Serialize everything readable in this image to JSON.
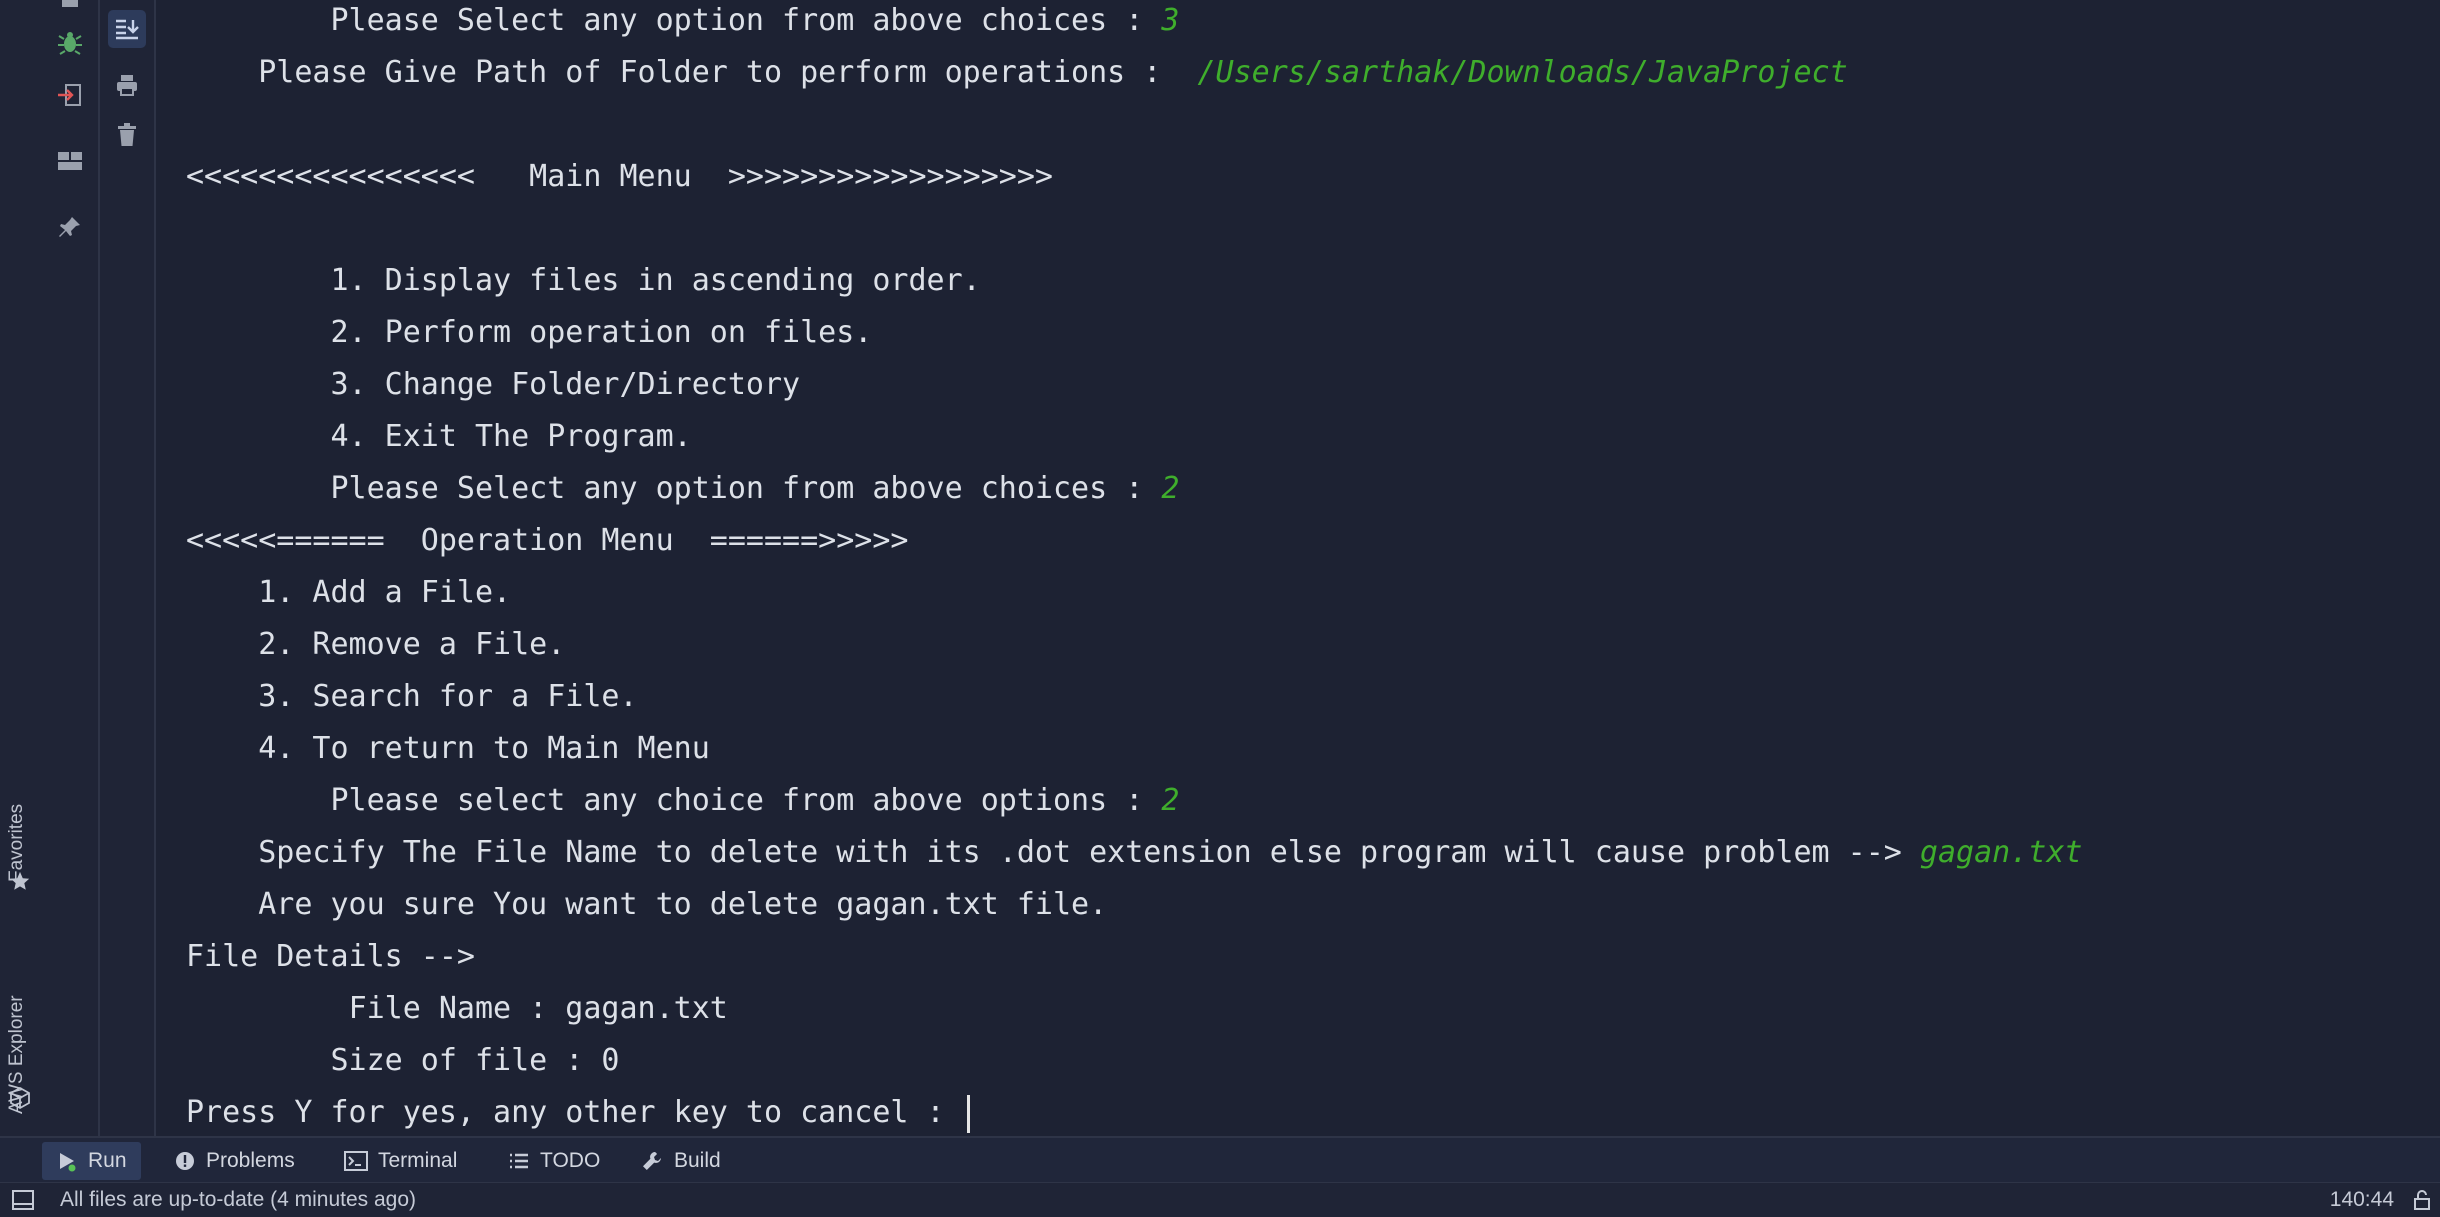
{
  "sidebar": {
    "favorites_label": "Favorites",
    "aws_label": "AWS Explorer"
  },
  "console": {
    "lines": [
      {
        "indent": "        ",
        "text": "Please Select any option from above choices : ",
        "input": "3"
      },
      {
        "indent": "    ",
        "text": "Please Give Path of Folder to perform operations :  ",
        "input": "/Users/sarthak/Downloads/JavaProject"
      },
      {
        "indent": "",
        "text": "",
        "input": ""
      },
      {
        "indent": "",
        "text": "<<<<<<<<<<<<<<<<   Main Menu  >>>>>>>>>>>>>>>>>>",
        "input": ""
      },
      {
        "indent": "",
        "text": "",
        "input": ""
      },
      {
        "indent": "        ",
        "text": "1. Display files in ascending order.",
        "input": ""
      },
      {
        "indent": "        ",
        "text": "2. Perform operation on files.",
        "input": ""
      },
      {
        "indent": "        ",
        "text": "3. Change Folder/Directory",
        "input": ""
      },
      {
        "indent": "        ",
        "text": "4. Exit The Program.",
        "input": ""
      },
      {
        "indent": "        ",
        "text": "Please Select any option from above choices : ",
        "input": "2"
      },
      {
        "indent": "",
        "text": "<<<<<======  Operation Menu  ======>>>>>",
        "input": ""
      },
      {
        "indent": "    ",
        "text": "1. Add a File.",
        "input": ""
      },
      {
        "indent": "    ",
        "text": "2. Remove a File.",
        "input": ""
      },
      {
        "indent": "    ",
        "text": "3. Search for a File.",
        "input": ""
      },
      {
        "indent": "    ",
        "text": "4. To return to Main Menu",
        "input": ""
      },
      {
        "indent": "        ",
        "text": "Please select any choice from above options : ",
        "input": "2"
      },
      {
        "indent": "    ",
        "text": "Specify The File Name to delete with its .dot extension else program will cause problem --> ",
        "input": "gagan.txt"
      },
      {
        "indent": "    ",
        "text": "Are you sure You want to delete gagan.txt file.",
        "input": ""
      },
      {
        "indent": "",
        "text": "File Details -->",
        "input": ""
      },
      {
        "indent": "         ",
        "text": "File Name : gagan.txt",
        "input": ""
      },
      {
        "indent": "        ",
        "text": "Size of file : 0",
        "input": ""
      },
      {
        "indent": "",
        "text": "Press Y for yes, any other key to cancel : ",
        "input": ""
      }
    ],
    "input_color": "#3fae2c",
    "text_color": "#dde1e8"
  },
  "tool_tabs": [
    {
      "label": "Run",
      "icon": "run-icon"
    },
    {
      "label": "Problems",
      "icon": "problems-icon"
    },
    {
      "label": "Terminal",
      "icon": "terminal-icon"
    },
    {
      "label": "TODO",
      "icon": "todo-icon"
    },
    {
      "label": "Build",
      "icon": "build-icon"
    }
  ],
  "status": {
    "message": "All files are up-to-date (4 minutes ago)",
    "caret_position": "140:44"
  },
  "colors": {
    "background": "#1d2233",
    "panel": "#1f2436",
    "active_tab": "#2f3c5c"
  }
}
